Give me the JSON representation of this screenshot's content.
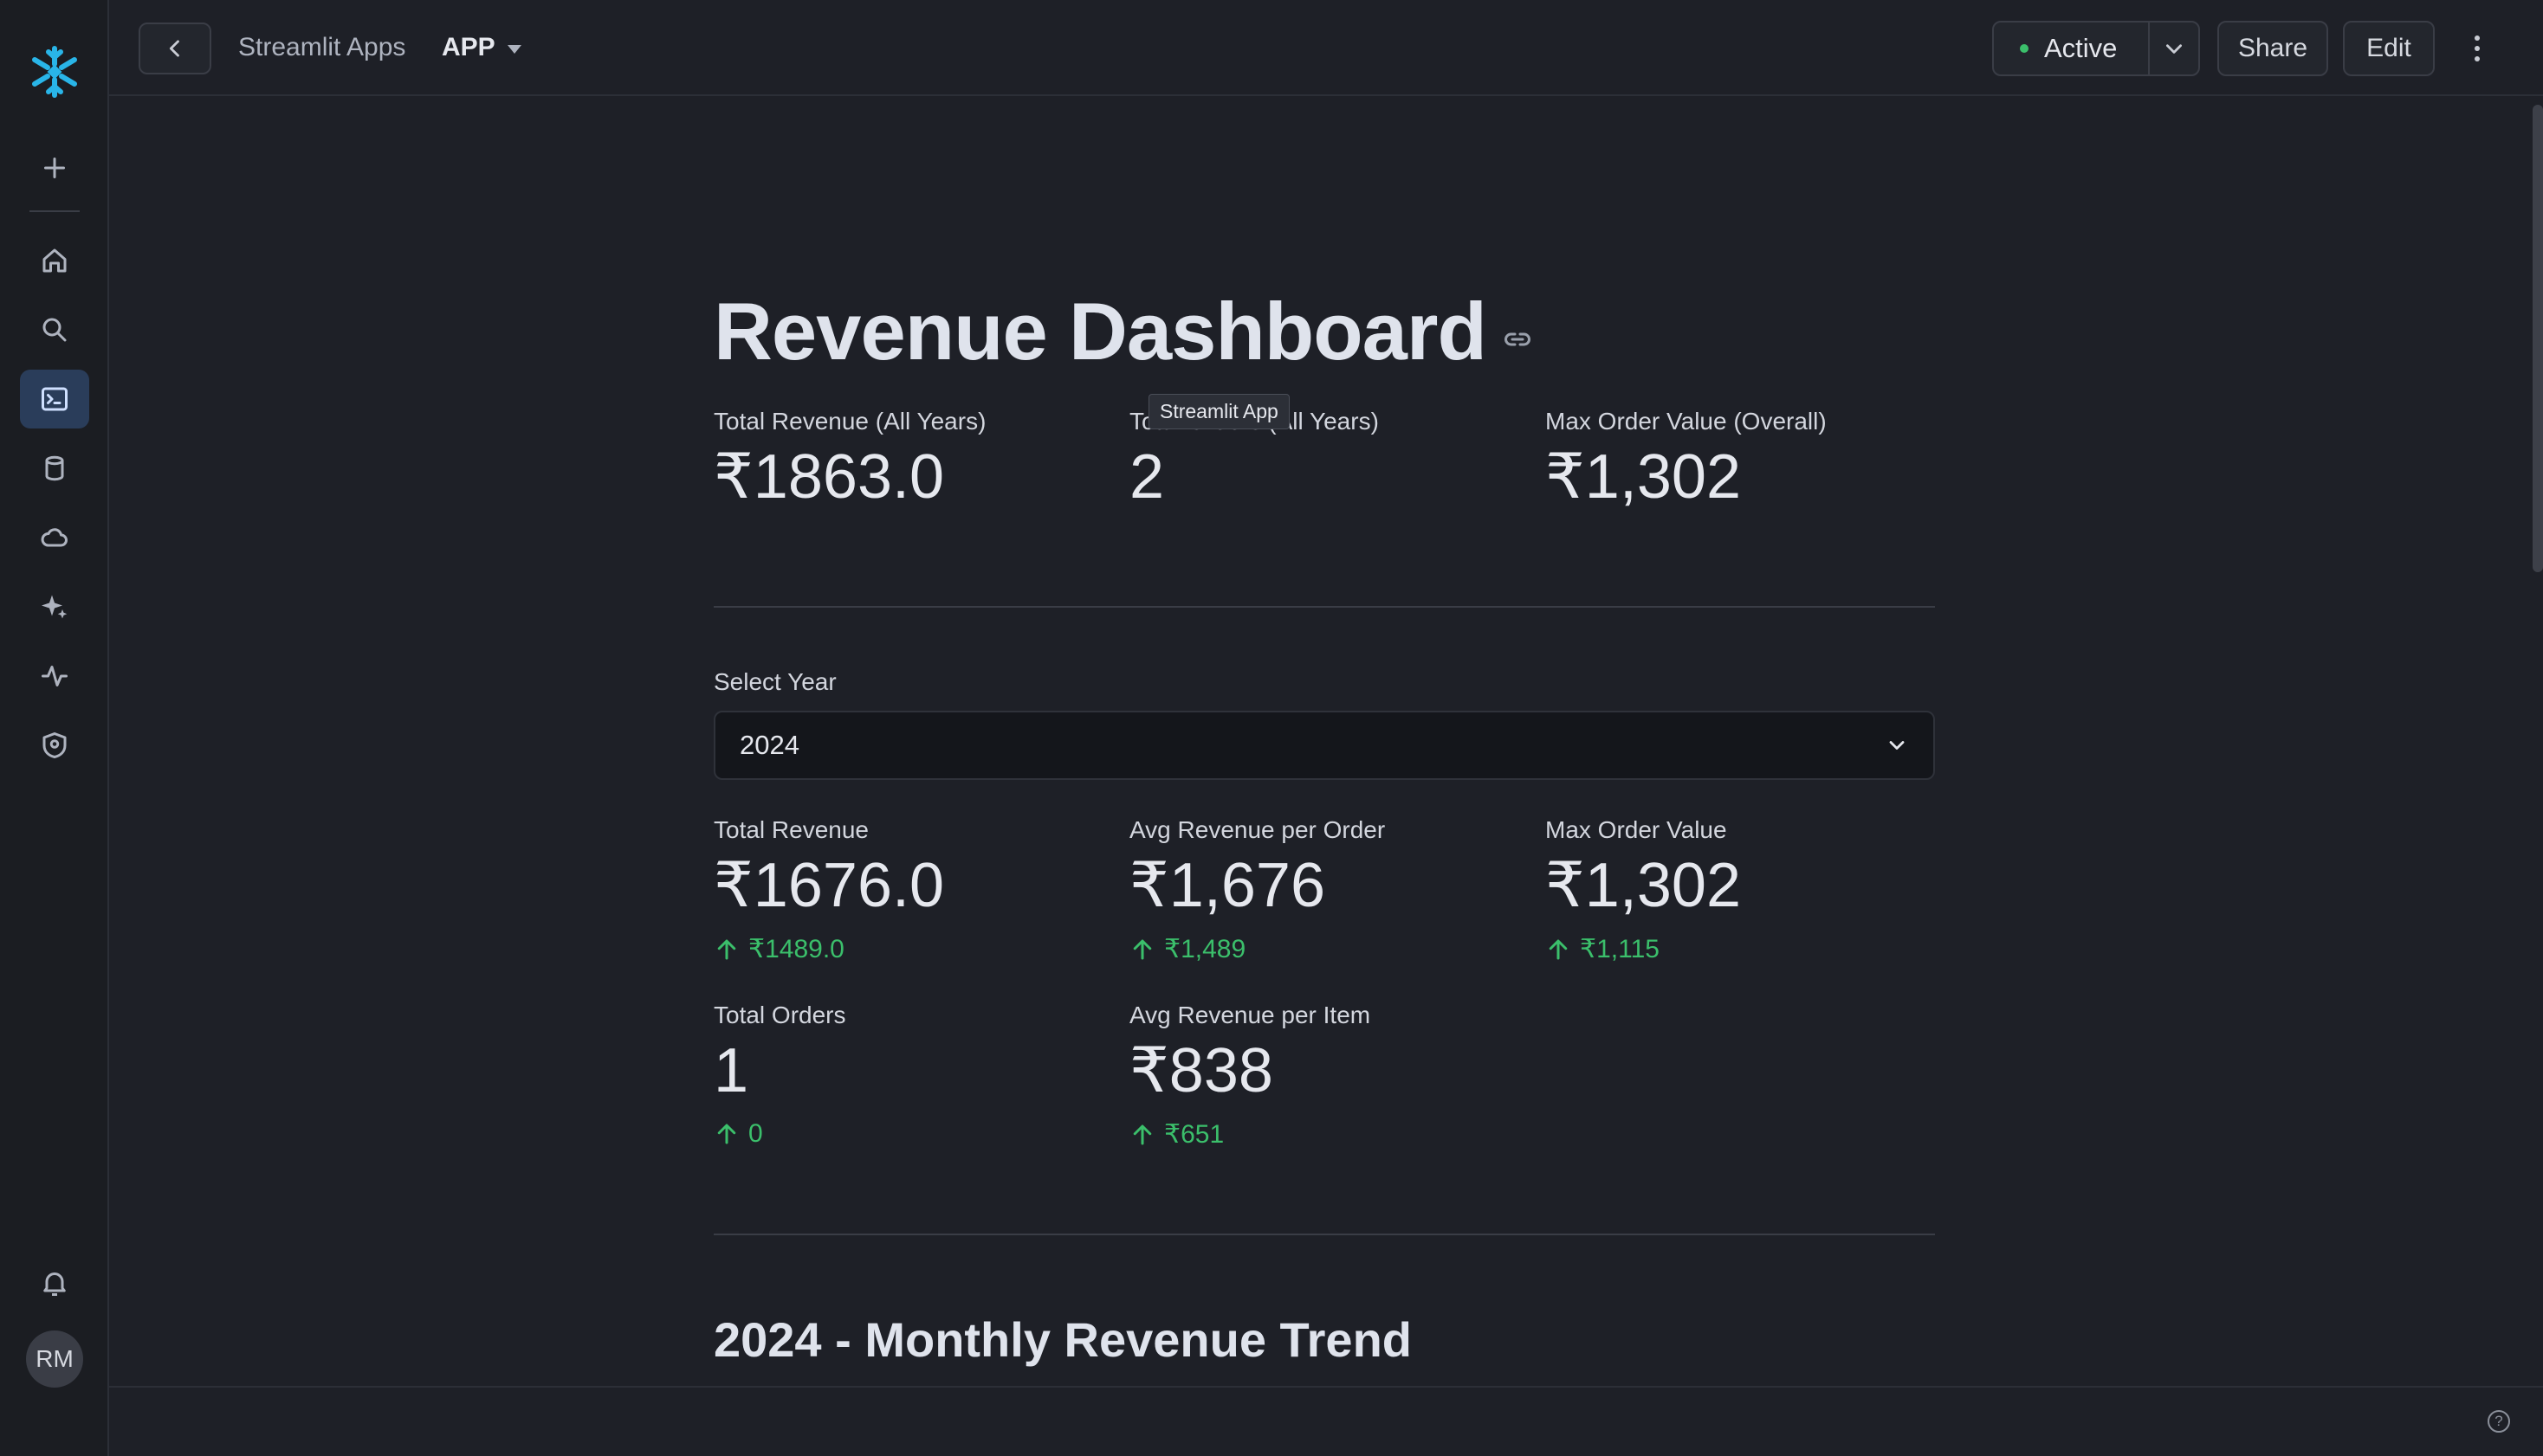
{
  "topbar": {
    "breadcrumb": "Streamlit Apps",
    "app_label": "APP",
    "status": "Active",
    "share_label": "Share",
    "edit_label": "Edit"
  },
  "rail": {
    "icons": [
      "plus-icon",
      "home-icon",
      "search-icon",
      "terminal-icon",
      "database-icon",
      "cloud-icon",
      "sparkle-icon",
      "activity-icon",
      "shield-icon",
      "bell-icon"
    ],
    "avatar_initials": "RM"
  },
  "dashboard": {
    "title": "Revenue Dashboard",
    "tooltip": "Streamlit App",
    "overall_metrics": [
      {
        "label": "Total Revenue (All Years)",
        "value": "₹1863.0"
      },
      {
        "label": "Total Orders (All Years)",
        "value": "2"
      },
      {
        "label": "Max Order Value (Overall)",
        "value": "₹1,302"
      }
    ],
    "select_label": "Select Year",
    "select_value": "2024",
    "year_metrics": [
      {
        "label": "Total Revenue",
        "value": "₹1676.0",
        "delta": "₹1489.0"
      },
      {
        "label": "Avg Revenue per Order",
        "value": "₹1,676",
        "delta": "₹1,489"
      },
      {
        "label": "Max Order Value",
        "value": "₹1,302",
        "delta": "₹1,115"
      },
      {
        "label": "Total Orders",
        "value": "1",
        "delta": "0"
      },
      {
        "label": "Avg Revenue per Item",
        "value": "₹838",
        "delta": "₹651"
      }
    ],
    "section_title": "2024 - Monthly Revenue Trend"
  },
  "colors": {
    "background": "#1e2027",
    "accent_active": "#2a3d5a",
    "delta_positive": "#3bbf6b",
    "status_dot": "#3bbf6b"
  }
}
